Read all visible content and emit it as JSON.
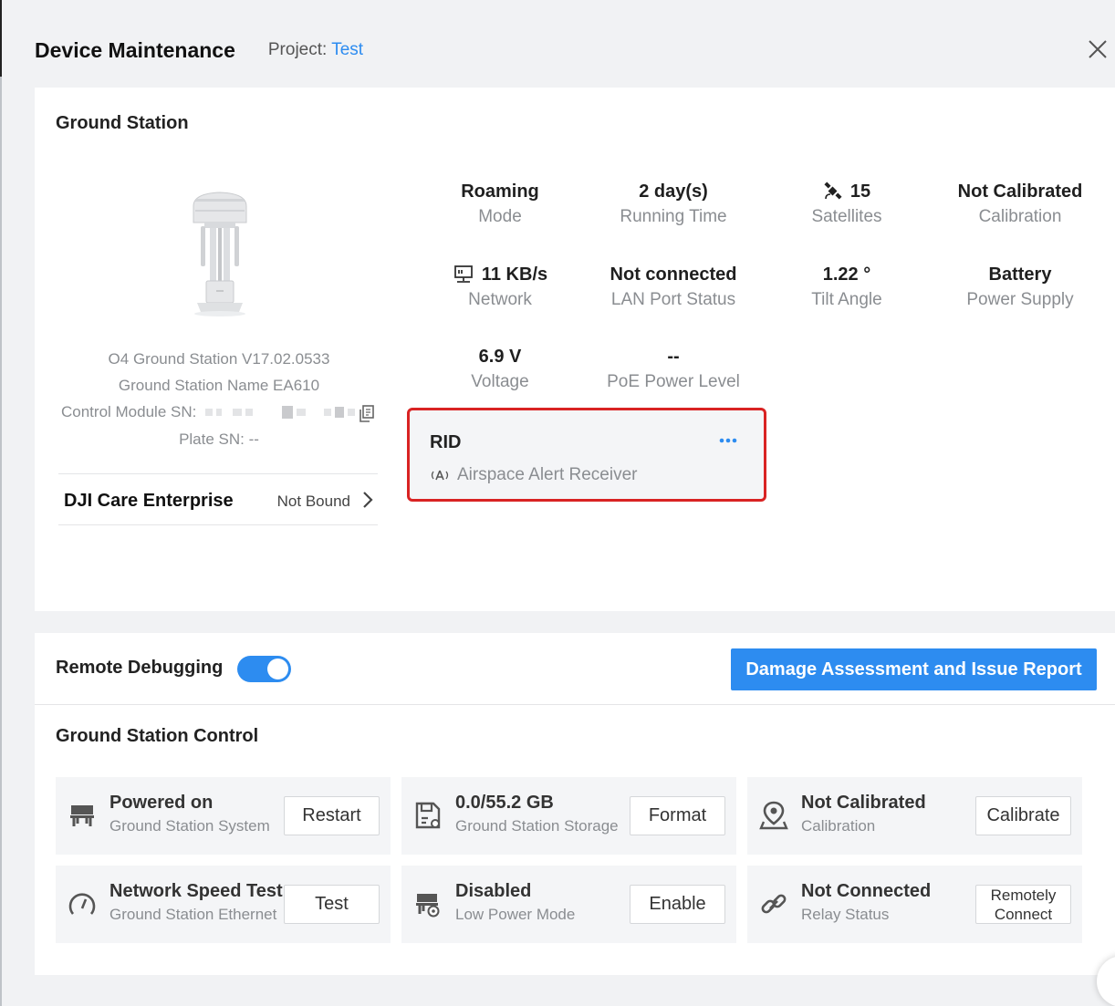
{
  "header": {
    "title": "Device Maintenance",
    "project_label": "Project:",
    "project_value": "Test"
  },
  "ground_station": {
    "section_title": "Ground Station",
    "firmware": "O4 Ground Station V17.02.0533",
    "name": "Ground Station Name EA610",
    "control_module_sn_label": "Control Module SN:",
    "plate_sn": "Plate SN: --",
    "care_label": "DJI Care Enterprise",
    "care_value": "Not Bound"
  },
  "stats": [
    {
      "value": "Roaming",
      "label": "Mode",
      "icon": ""
    },
    {
      "value": "2 day(s)",
      "label": "Running Time",
      "icon": ""
    },
    {
      "value": "15",
      "label": "Satellites",
      "icon": "satellite-icon"
    },
    {
      "value": "Not Calibrated",
      "label": "Calibration",
      "icon": ""
    },
    {
      "value": "11 KB/s",
      "label": "Network",
      "icon": "network-icon"
    },
    {
      "value": "Not connected",
      "label": "LAN Port Status",
      "icon": ""
    },
    {
      "value": "1.22 °",
      "label": "Tilt Angle",
      "icon": ""
    },
    {
      "value": "Battery",
      "label": "Power Supply",
      "icon": ""
    },
    {
      "value": "6.9 V",
      "label": "Voltage",
      "icon": ""
    },
    {
      "value": "--",
      "label": "PoE Power Level",
      "icon": ""
    }
  ],
  "rid": {
    "title": "RID",
    "subtitle": "Airspace Alert Receiver"
  },
  "remote_debugging": {
    "label": "Remote Debugging",
    "enabled": true,
    "toggle_color": "#2d8cf0"
  },
  "report_button": "Damage Assessment and Issue Report",
  "control": {
    "section_title": "Ground Station Control",
    "tiles": [
      {
        "main": "Powered on",
        "sub": "Ground Station System",
        "button": "Restart",
        "icon": "power-icon"
      },
      {
        "main": "0.0/55.2 GB",
        "sub": "Ground Station Storage",
        "button": "Format",
        "icon": "storage-icon"
      },
      {
        "main": "Not Calibrated",
        "sub": "Calibration",
        "button": "Calibrate",
        "icon": "location-pin-icon"
      },
      {
        "main": "Network Speed Test",
        "sub": "Ground Station Ethernet",
        "button": "Test",
        "icon": "speedometer-icon"
      },
      {
        "main": "Disabled",
        "sub": "Low Power Mode",
        "button": "Enable",
        "icon": "low-power-icon"
      },
      {
        "main": "Not Connected",
        "sub": "Relay Status",
        "button": "Remotely Connect",
        "icon": "link-icon"
      }
    ]
  },
  "colors": {
    "accent": "#2d8cf0",
    "highlight_border": "#d92323"
  }
}
